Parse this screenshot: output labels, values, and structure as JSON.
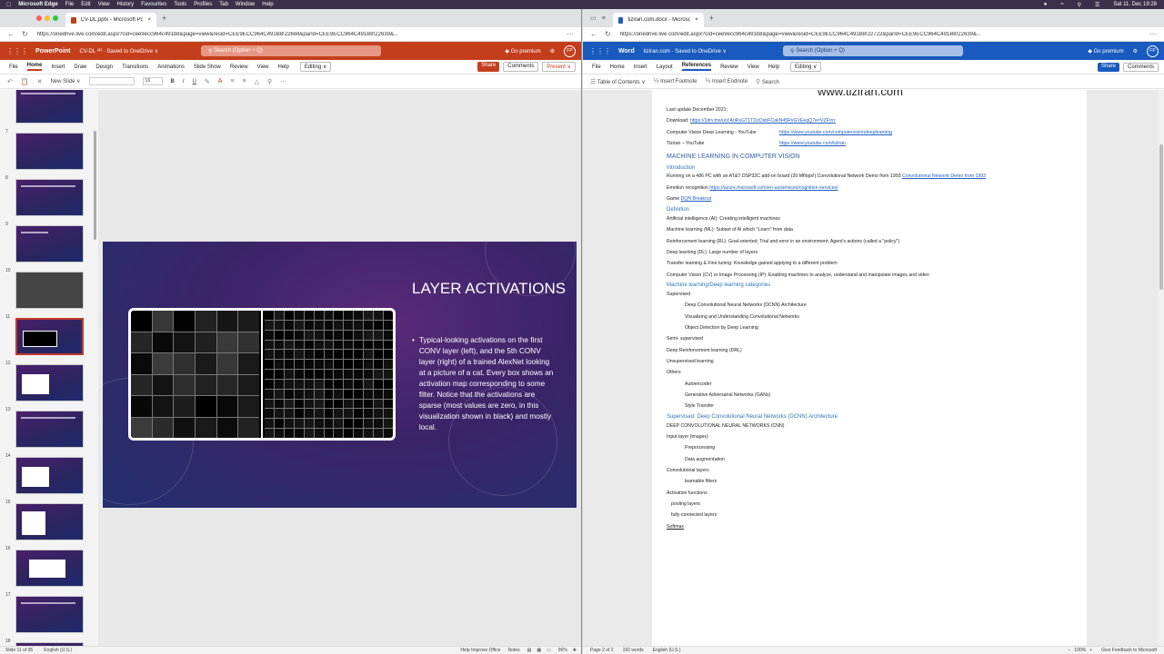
{
  "mac": {
    "menu": [
      "Microsoft Edge",
      "File",
      "Edit",
      "View",
      "History",
      "Favourites",
      "Tools",
      "Profiles",
      "Tab",
      "Window",
      "Help"
    ],
    "clock": "Sat 11. Dec 19:28"
  },
  "left": {
    "tab_title": "CV-DL.pptx - Microsoft PowerP...",
    "url": "https://onedrive.live.com/edit.aspx?cid=cee9ecc964c491b8&page=view&resid=CEE9ECC964C491B8!22684&parId=CEE9ECC964C491B8!22639&...",
    "app_name": "PowerPoint",
    "doc_name": "CV-DL ᴬᴿ · Saved to OneDrive ∨",
    "search_placeholder": "Search (Option + Q)",
    "premium": "Go premium",
    "avatar": "FP",
    "ribbon_tabs": [
      "File",
      "Home",
      "Insert",
      "Draw",
      "Design",
      "Transitions",
      "Animations",
      "Slide Show",
      "Review",
      "View",
      "Help"
    ],
    "active_tab": "Home",
    "editing": "Editing ∨",
    "share": "Share",
    "comments": "Comments",
    "present": "Present ∨",
    "new_slide": "New Slide ∨",
    "font_size": "16",
    "thumbs": [
      "7",
      "8",
      "9",
      "10",
      "11",
      "12",
      "13",
      "14",
      "15",
      "16",
      "17",
      "18"
    ],
    "selected_thumb": "11",
    "slide": {
      "title": "LAYER ACTIVATIONS",
      "bullet": "Typical-looking activations on the first CONV layer (left), and the 5th CONV layer (right) of a trained AlexNet looking at a picture of a cat. Every box shows an activation map corresponding to some filter. Notice that the activations are sparse (most values are zero, in this visualization shown in black) and mostly local."
    },
    "status": {
      "slide_count": "Slide 11 of 95",
      "language": "English (U.S.)",
      "help": "Help Improve Office",
      "notes": "Notes",
      "zoom": "96%"
    }
  },
  "right": {
    "tab_title": "tiziran.com.docx - Microsoft W...",
    "url": "https://onedrive.live.com/edit.aspx?cid=cee9ecc964c491b8&page=view&resid=CEE9ECC964C491B8!22722&parId=CEE9ECC964C491B8!22639&...",
    "app_name": "Word",
    "doc_name": "tiziran.com · Saved to OneDrive ∨",
    "search_placeholder": "Search (Option + Q)",
    "premium": "Go premium",
    "avatar": "FP",
    "ribbon_tabs": [
      "File",
      "Home",
      "Insert",
      "Layout",
      "References",
      "Review",
      "View",
      "Help"
    ],
    "active_tab": "References",
    "editing": "Editing ∨",
    "share": "Share",
    "comments": "Comments",
    "toolbar": [
      "Table of Contents ∨",
      "Insert Footnote",
      "Insert Endnote",
      "Search"
    ],
    "doc_title": "www.tiziran.com",
    "lines": {
      "l1": "Last update December 2021;",
      "l2a": "Download: ",
      "l2b": "https://1drv.ms/u/s!AriRsGT1TDzOsbFCakN45RvGVEeqQ?e=VZFrrrr",
      "l3a": "Computer Vision Deep Learning - YouTube",
      "l3b": "https://www.youtube.com/computervisiondeeplearning",
      "l4a": "Tiziran – YouTube",
      "l4b": "https://www.youtube.com/tiziran",
      "h1": "MACHINE LEARNING IN COMPUTER VISION",
      "h2a": "Introduction",
      "l5a": "Running on a 486 PC with an AT&T DSP32C add-on board (20 Mflops!) Convolutional Network Demo from 1993 ",
      "l5b": "Convolutional Network Demo from 1993",
      "l6a": "Emotion recognition ",
      "l6b": "https://azure.microsoft.com/en-us/services/cognitive-services/",
      "l7a": "Game ",
      "l7b": "DQN Breakout",
      "h2b": "Definition",
      "d1": "Artificial intelligence (AI): Creating intelligent machines",
      "d2": "Machine learning (ML): Subset of AI which \"Learn\" from data",
      "d3": "Reinforcement learning (RL): Goal-oriented; Trial and error in an environment; Agent's actions (called a \"policy\")",
      "d4": "Deep learning (DL): Large number of layers",
      "d5": "Transfer learning & Fine tuning: Knowledge gained applying to a different problem",
      "d6": "Computer Vision (CV) or Image Processing (IP): Enabling machines to analyze, understand and manipulate images and video",
      "h2c": "Machine learning/Deep learning categories",
      "c1": "Supervised",
      "c2": "Deep Convolutional Neural Networks (DCNN) Architecture",
      "c3": "Visualizing and Understanding Convolutional Networks",
      "c4": "Object Detection by Deep Learning",
      "c5": "Semi- supervised",
      "c6": "Deep Reinforcement learning (DRL)",
      "c7": "Unsupervised learning",
      "c8": "Others",
      "c9": "Autoencoder",
      "c10": "Generative Adversarial Networks (GANs)",
      "c11": "Style Transfer",
      "h2d": "Supervised: Deep Convolutional Neural Networks (DCNN) Architecture",
      "s1": "DEEP CONVOLUTIONAL NEURAL NETWORKS (CNN)",
      "s2": "Input layer (images)",
      "s3": "Preprocessing",
      "s4": "Data augmentation",
      "s5": "Convolutional layers",
      "s6": "learnable filters",
      "s7": "Activation functions",
      "s8": "pooling layers",
      "s9": "fully-connected layers",
      "s10": "Softmax"
    },
    "status": {
      "page": "Page 2 of 2",
      "words": "192 words",
      "language": "English (U.S.)",
      "zoom": "100%",
      "feedback": "Give Feedback to Microsoft"
    }
  },
  "colors": {
    "ppt": "#c43e1c",
    "word": "#185abd",
    "mac_bar": "#3a3049"
  }
}
